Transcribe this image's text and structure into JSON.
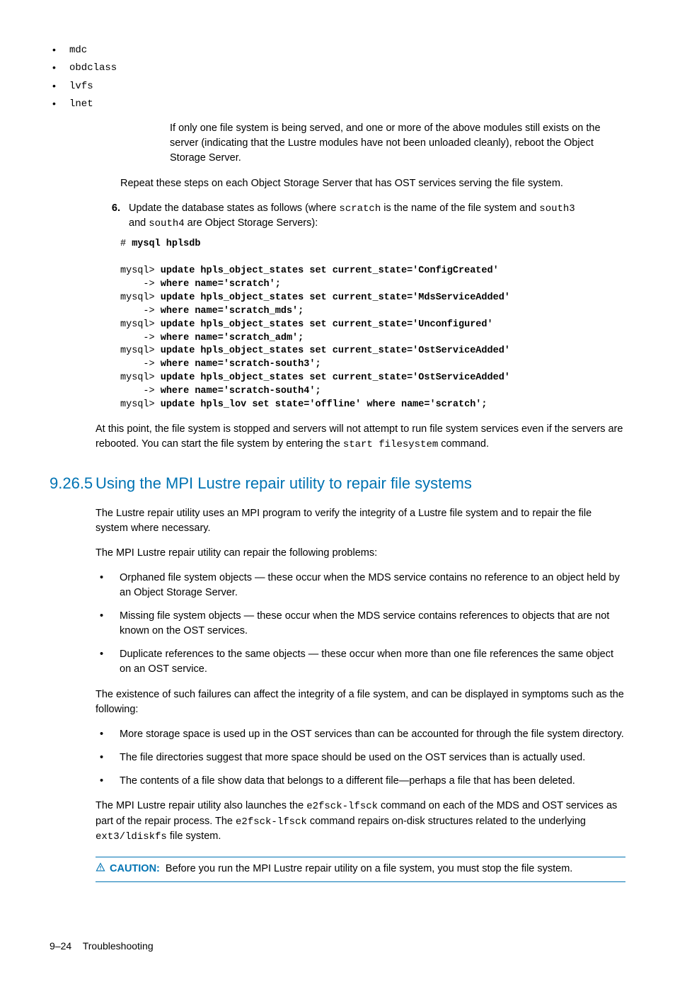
{
  "innerModules": [
    "mdc",
    "obdclass",
    "lvfs",
    "lnet"
  ],
  "paraAfterModules": "If only one file system is being served, and one or more of the above modules still exists on the server (indicating that the Lustre modules have not been unloaded cleanly), reboot the Object Storage Server.",
  "repeatSteps": "Repeat these steps on each Object Storage Server that has OST services serving the file system.",
  "step6": {
    "num": "6.",
    "text1": "Update the database states as follows (where ",
    "code1": "scratch",
    "text2": " is the name of the file system and ",
    "code2": "south3",
    "text3a": "and ",
    "code3": "south4",
    "text3b": " are Object Storage Servers):"
  },
  "codeBlock": {
    "l1p": "# ",
    "l1b": "mysql hplsdb",
    "l3p": "mysql> ",
    "l3b": "update hpls_object_states set current_state='ConfigCreated'",
    "l4p": "    -> ",
    "l4b": "where name='scratch';",
    "l5p": "mysql> ",
    "l5b": "update hpls_object_states set current_state='MdsServiceAdded'",
    "l6p": "    -> ",
    "l6b": "where name='scratch_mds';",
    "l7p": "mysql> ",
    "l7b": "update hpls_object_states set current_state='Unconfigured'",
    "l8p": "    -> ",
    "l8b": "where name='scratch_adm';",
    "l9p": "mysql> ",
    "l9b": "update hpls_object_states set current_state='OstServiceAdded'",
    "l10p": "    -> ",
    "l10b": "where name='scratch-south3';",
    "l11p": "mysql> ",
    "l11b": "update hpls_object_states set current_state='OstServiceAdded'",
    "l12p": "    -> ",
    "l12b": "where name='scratch-south4';",
    "l13p": "mysql> ",
    "l13b": "update hpls_lov set state='offline' where name='scratch';"
  },
  "afterCode": {
    "p1a": "At this point, the file system is stopped and servers will not attempt to run file system services even if the servers are rebooted. You can start the file system by entering the ",
    "p1code": "start filesystem",
    "p1b": " command."
  },
  "section": {
    "num": "9.26.5",
    "title": "Using the MPI Lustre repair utility to repair file systems"
  },
  "sec": {
    "p1": "The Lustre repair utility uses an MPI program to verify the integrity of a Lustre file system and to repair the file system where necessary.",
    "p2": "The MPI Lustre repair utility can repair the following problems:",
    "bullets1": [
      "Orphaned file system objects — these occur when the MDS service contains no reference to an object held by an Object Storage Server.",
      "Missing file system objects — these occur when the MDS service contains references to objects that are not known on the OST services.",
      "Duplicate references to the same objects — these occur when more than one file references the same object on an OST service."
    ],
    "p3": "The existence of such failures can affect the integrity of a file system, and can be displayed in symptoms such as the following:",
    "bullets2": [
      "More storage space is used up in the OST services than can be accounted for through the file system directory.",
      "The file directories suggest that more space should be used on the OST services than is actually used.",
      "The contents of a file show data that belongs to a different file—perhaps a file that has been deleted."
    ],
    "p4a": "The MPI Lustre repair utility also launches the ",
    "p4code1": "e2fsck-lfsck",
    "p4b": " command on each of the MDS and OST services as part of the repair process. The ",
    "p4code2": "e2fsck-lfsck",
    "p4c": " command repairs on-disk structures related to the underlying ",
    "p4code3": "ext3/ldiskfs",
    "p4d": " file system."
  },
  "caution": {
    "label": "CAUTION:",
    "text": " Before you run the MPI Lustre repair utility on a file system, you must stop the file system."
  },
  "footer": {
    "page": "9–24",
    "chapter": "Troubleshooting"
  }
}
